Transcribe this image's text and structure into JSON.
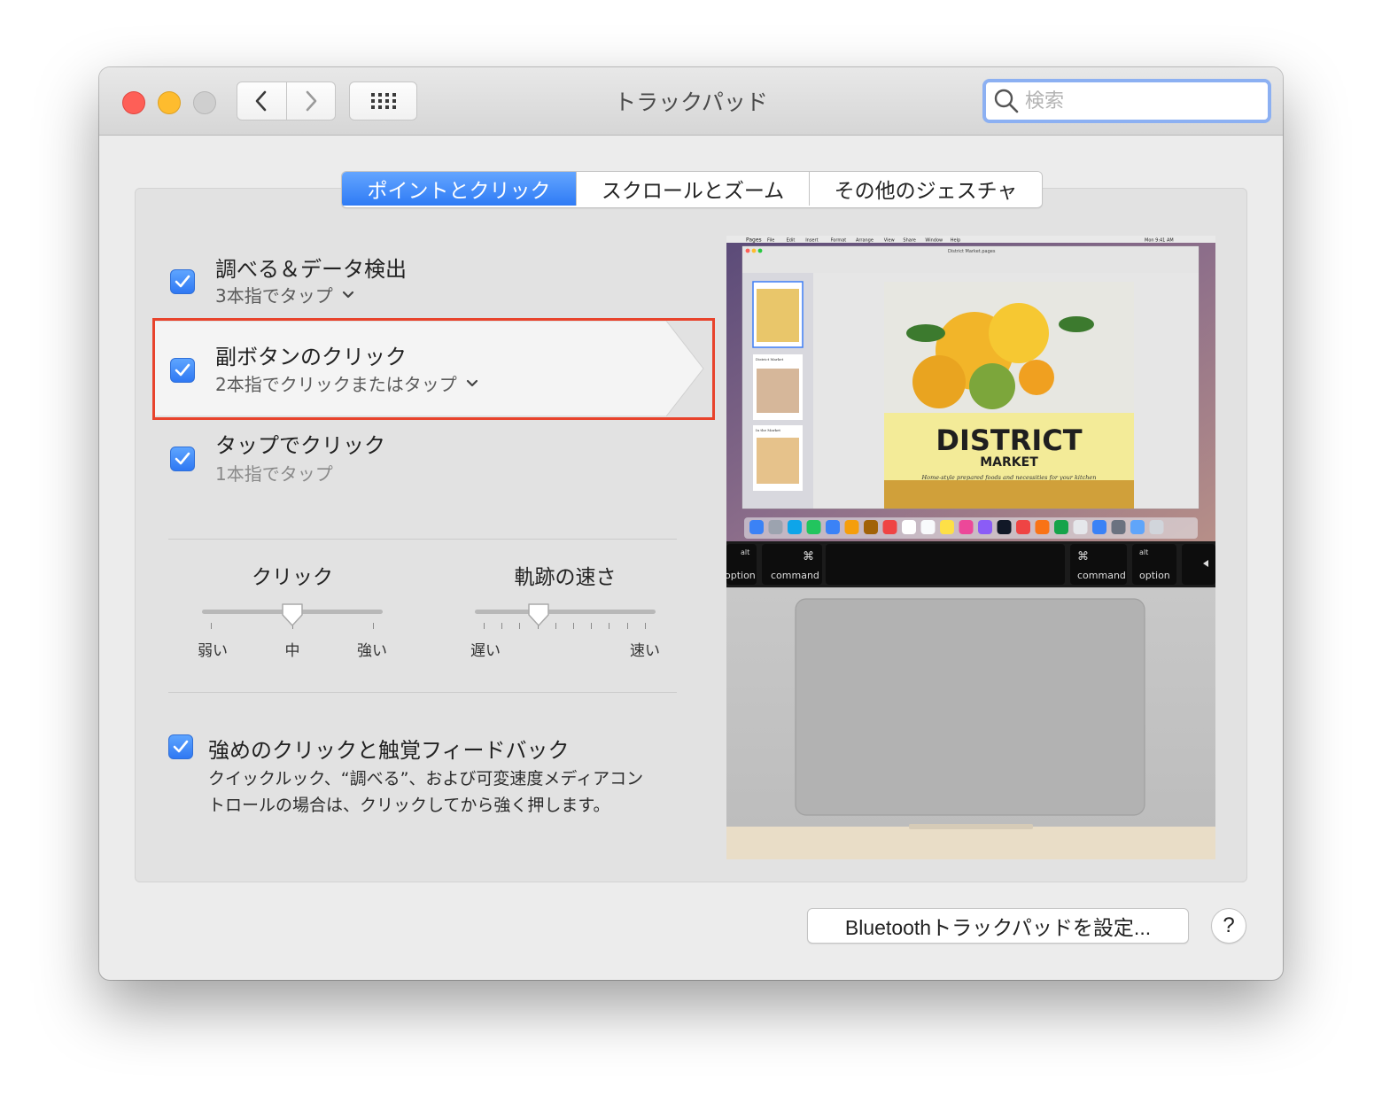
{
  "window": {
    "title": "トラックパッド",
    "search_placeholder": "検索"
  },
  "tabs": [
    {
      "label": "ポイントとクリック",
      "active": true
    },
    {
      "label": "スクロールとズーム",
      "active": false
    },
    {
      "label": "その他のジェスチャ",
      "active": false
    }
  ],
  "options": [
    {
      "title": "調べる＆データ検出",
      "subtitle": "3本指でタップ",
      "checked": true,
      "has_menu": true
    },
    {
      "title": "副ボタンのクリック",
      "subtitle": "2本指でクリックまたはタップ",
      "checked": true,
      "has_menu": true,
      "highlighted": true
    },
    {
      "title": "タップでクリック",
      "subtitle": "1本指でタップ",
      "checked": true,
      "has_menu": false
    }
  ],
  "sliders": {
    "click": {
      "label": "クリック",
      "min_label": "弱い",
      "mid_label": "中",
      "max_label": "強い",
      "value": 0.5
    },
    "tracking": {
      "label": "軌跡の速さ",
      "min_label": "遅い",
      "max_label": "速い",
      "value": 0.35
    }
  },
  "force_click": {
    "title": "強めのクリックと触覚フィードバック",
    "description_line1": "クイックルック、“調べる”、および可変速度メディアコン",
    "description_line2": "トロールの場合は、クリックしてから強く押します。",
    "checked": true
  },
  "preview": {
    "menubar_app": "Pages",
    "menubar_items": [
      "File",
      "Edit",
      "Insert",
      "Format",
      "Arrange",
      "View",
      "Share",
      "Window",
      "Help"
    ],
    "menubar_time": "Mon 9:41 AM",
    "doc_title": "District Market.pages",
    "page_title_line1": "DISTRICT",
    "page_title_line2": "MARKET",
    "page_tagline": "Home-style prepared foods and necessities for your kitchen",
    "thumb2_title": "District Market",
    "thumb3_title": "In the Market",
    "key_left_small": "alt",
    "key_left_label": "option",
    "key_command_label": "command",
    "key_command_symbol": "⌘",
    "key_right_command_label": "command",
    "key_right_option_small": "alt",
    "key_right_option_label": "option"
  },
  "footer": {
    "bluetooth_button": "Bluetoothトラックパッドを設定...",
    "help_button": "?"
  },
  "colors": {
    "accent": "#2f7bf5",
    "highlight_border": "#e8432c"
  }
}
